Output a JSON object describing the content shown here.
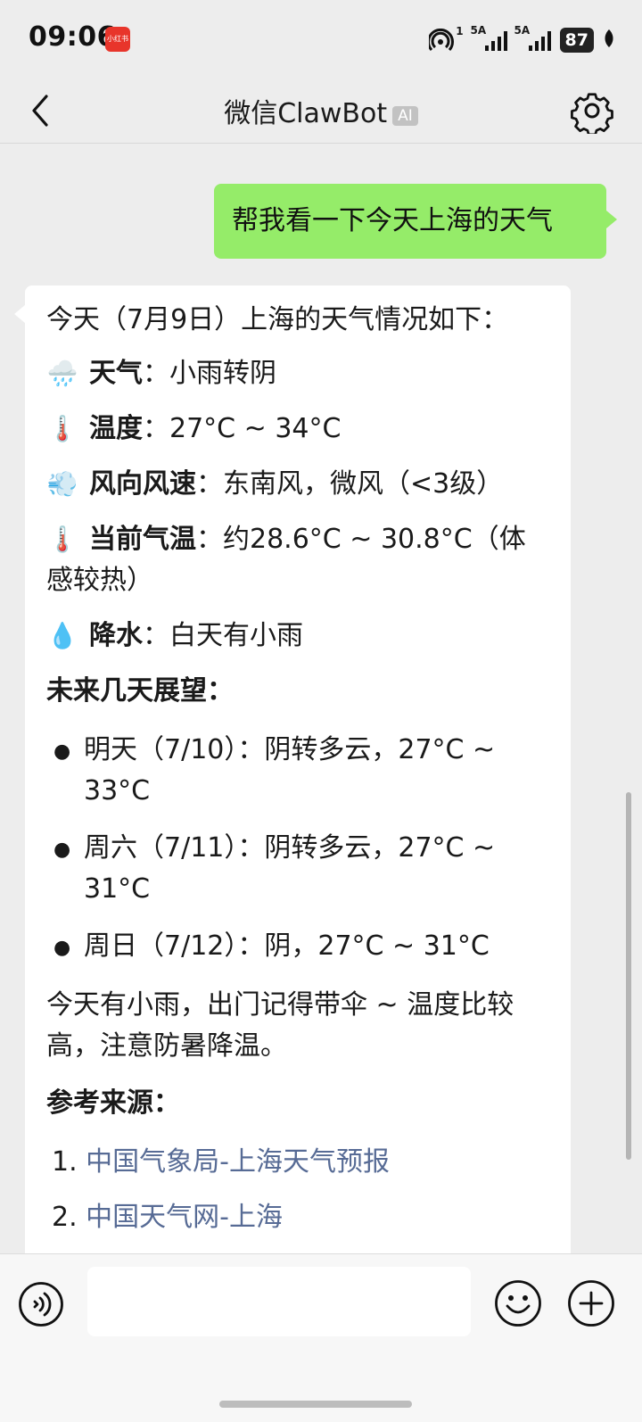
{
  "status_bar": {
    "time": "09:06",
    "app_badge": "小红书",
    "hotspot_count": "1",
    "sim1_label": "5A",
    "sim2_label": "5A",
    "battery": "87"
  },
  "header": {
    "title": "微信ClawBot",
    "badge": "AI"
  },
  "messages": {
    "user": "帮我看一下今天上海的天气",
    "bot": {
      "intro": "今天（7月9日）上海的天气情况如下：",
      "weather_label": "天气",
      "weather_value": "：小雨转阴",
      "temp_label": "温度",
      "temp_value": "：27°C ~ 34°C",
      "wind_label": "风向风速",
      "wind_value": "：东南风，微风（<3级）",
      "current_label": "当前气温",
      "current_value_1": "：约28.6°C ~ 30.8°C（体",
      "current_value_2": "感较热）",
      "rain_label": "降水",
      "rain_value": "：白天有小雨",
      "forecast_heading": "未来几天展望：",
      "forecast": [
        {
          "line1": "明天（7/10）：阴转多云，27°C ~",
          "line2": "33°C"
        },
        {
          "line1": "周六（7/11）：阴转多云，27°C ~",
          "line2": "31°C"
        },
        {
          "line1": "周日（7/12）：阴，27°C ~ 31°C",
          "line2": ""
        }
      ],
      "tip_1": "今天有小雨，出门记得带伞 ~ 温度比较",
      "tip_2": "高，注意防暑降温。",
      "sources_heading": "参考来源：",
      "sources": [
        {
          "num": "1.",
          "text": "中国气象局-上海天气预报"
        },
        {
          "num": "2.",
          "text": "中国天气网-上海"
        }
      ]
    }
  },
  "input": {
    "value": "",
    "placeholder": ""
  },
  "icons": {
    "weather": "cloud-rain-icon",
    "temperature": "thermometer-icon",
    "wind": "wind-icon",
    "current_temp": "thermometer-icon",
    "precipitation": "droplet-icon"
  },
  "colors": {
    "background": "#ededed",
    "user_bubble": "#95ec69",
    "bot_bubble": "#ffffff",
    "link": "#576b95"
  }
}
